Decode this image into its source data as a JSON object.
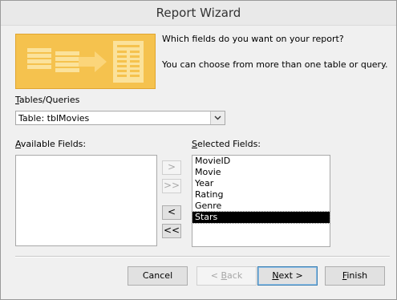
{
  "window": {
    "title": "Report Wizard"
  },
  "banner": {
    "icon": "report-wizard-graphic-icon",
    "colors": {
      "background": "#f5c24e",
      "accent": "#fbe29b"
    }
  },
  "prompt": {
    "question": "Which fields do you want on your report?",
    "hint": "You can choose from more than one table or query."
  },
  "tables_queries": {
    "label_accel": "T",
    "label_rest": "ables/Queries",
    "selected": "Table: tblMovies",
    "dropdown_icon": "chevron-down-icon"
  },
  "available_fields": {
    "label_accel": "A",
    "label_rest": "vailable Fields:",
    "items": []
  },
  "selected_fields": {
    "label_accel": "S",
    "label_rest": "elected Fields:",
    "items": [
      "MovieID",
      "Movie",
      "Year",
      "Rating",
      "Genre",
      "Stars"
    ],
    "selected_item": "Stars"
  },
  "move_buttons": {
    "add_one": ">",
    "add_all": ">>",
    "remove_one": "<",
    "remove_all": "<<"
  },
  "footer": {
    "cancel": "Cancel",
    "back_prefix": "< ",
    "back_accel": "B",
    "back_rest": "ack",
    "next_accel": "N",
    "next_rest": "ext >",
    "finish_accel": "F",
    "finish_rest": "inish"
  }
}
